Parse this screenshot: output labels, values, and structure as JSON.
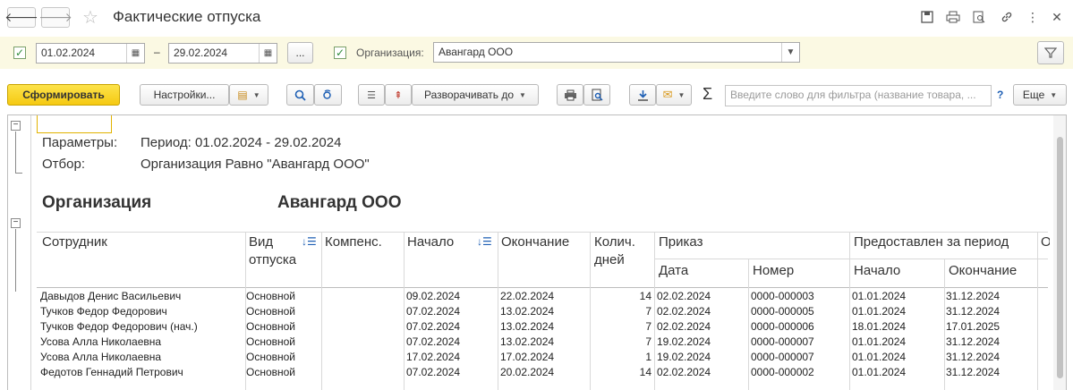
{
  "window": {
    "title": "Фактические отпуска",
    "back_icon": "arrow-left-icon",
    "forward_icon": "arrow-right-icon",
    "favorite_icon": "star-icon"
  },
  "filter": {
    "date_from": "01.02.2024",
    "date_to": "29.02.2024",
    "separator": "–",
    "ellipsis": "...",
    "org_label": "Организация:",
    "org_value": "Авангард ООО"
  },
  "toolbar": {
    "generate": "Сформировать",
    "settings": "Настройки...",
    "expand_to": "Разворачивать до",
    "sum_symbol": "Σ",
    "search_placeholder": "Введите слово для фильтра (название товара, ...",
    "help": "?",
    "more": "Еще"
  },
  "report": {
    "params_label": "Параметры:",
    "params_value": "Период: 01.02.2024 - 29.02.2024",
    "filter_label": "Отбор:",
    "filter_value": "Организация Равно \"Авангард ООО\"",
    "group_label": "Организация",
    "group_value": "Авангард ООО",
    "headers": {
      "employee": "Сотрудник",
      "leave_type": "Вид отпуска",
      "compensation": "Компенс.",
      "start": "Начало",
      "end": "Окончание",
      "days": "Колич. дней",
      "order": "Приказ",
      "order_date": "Дата",
      "order_number": "Номер",
      "period": "Предоставлен за период",
      "period_start": "Начало",
      "period_end": "Окончание",
      "extra": "Ос"
    },
    "rows": [
      {
        "employee": "Давыдов Денис Васильевич",
        "type": "Основной",
        "start": "09.02.2024",
        "end": "22.02.2024",
        "days": "14",
        "order_date": "02.02.2024",
        "order_number": "0000-000003",
        "period_start": "01.01.2024",
        "period_end": "31.12.2024"
      },
      {
        "employee": "Тучков Федор Федорович",
        "type": "Основной",
        "start": "07.02.2024",
        "end": "13.02.2024",
        "days": "7",
        "order_date": "02.02.2024",
        "order_number": "0000-000005",
        "period_start": "01.01.2024",
        "period_end": "31.12.2024"
      },
      {
        "employee": "Тучков Федор Федорович (нач.)",
        "type": "Основной",
        "start": "07.02.2024",
        "end": "13.02.2024",
        "days": "7",
        "order_date": "02.02.2024",
        "order_number": "0000-000006",
        "period_start": "18.01.2024",
        "period_end": "17.01.2025"
      },
      {
        "employee": "Усова Алла Николаевна",
        "type": "Основной",
        "start": "07.02.2024",
        "end": "13.02.2024",
        "days": "7",
        "order_date": "19.02.2024",
        "order_number": "0000-000007",
        "period_start": "01.01.2024",
        "period_end": "31.12.2024"
      },
      {
        "employee": "Усова Алла Николаевна",
        "type": "Основной",
        "start": "17.02.2024",
        "end": "17.02.2024",
        "days": "1",
        "order_date": "19.02.2024",
        "order_number": "0000-000007",
        "period_start": "01.01.2024",
        "period_end": "31.12.2024"
      },
      {
        "employee": "Федотов Геннадий Петрович",
        "type": "Основной",
        "start": "07.02.2024",
        "end": "20.02.2024",
        "days": "14",
        "order_date": "02.02.2024",
        "order_number": "0000-000002",
        "period_start": "01.01.2024",
        "period_end": "31.12.2024"
      }
    ]
  }
}
